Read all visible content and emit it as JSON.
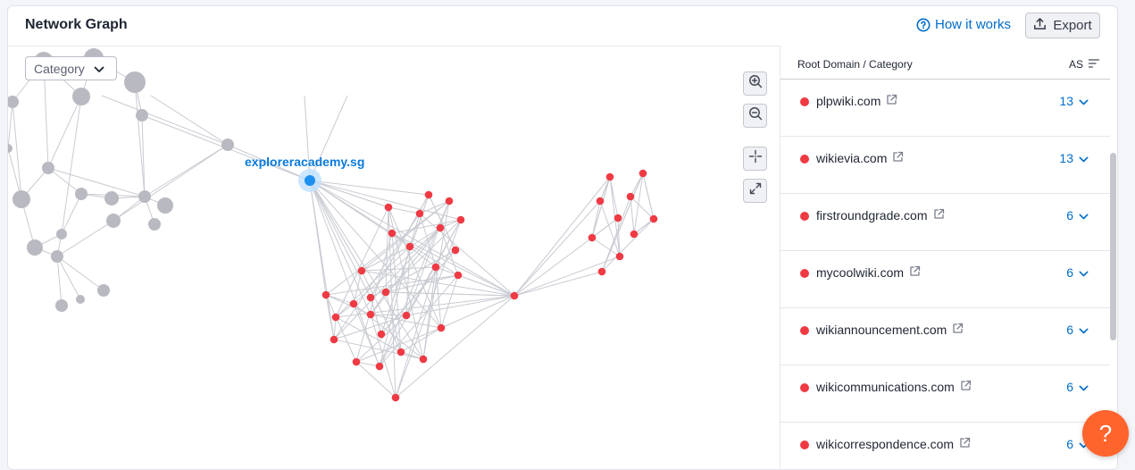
{
  "header": {
    "title": "Network Graph",
    "how_it_works": "How it works",
    "export_label": "Export"
  },
  "graph": {
    "category_select": "Category",
    "focus_label": "exploreracademy.sg",
    "colors": {
      "gray_node": "#b9bac1",
      "red_node": "#ef3a44",
      "focus_node": "#1e90ef",
      "edge": "#c9cbd2"
    }
  },
  "panel": {
    "col_domain": "Root Domain / Category",
    "col_as": "AS",
    "rows": [
      {
        "domain": "plpwiki.com",
        "as": "13"
      },
      {
        "domain": "wikievia.com",
        "as": "13"
      },
      {
        "domain": "firstroundgrade.com",
        "as": "6"
      },
      {
        "domain": "mycoolwiki.com",
        "as": "6"
      },
      {
        "domain": "wikiannouncement.com",
        "as": "6"
      },
      {
        "domain": "wikicommunications.com",
        "as": "6"
      },
      {
        "domain": "wikicorrespondence.com",
        "as": "6"
      }
    ]
  },
  "help": {
    "label": "?"
  }
}
